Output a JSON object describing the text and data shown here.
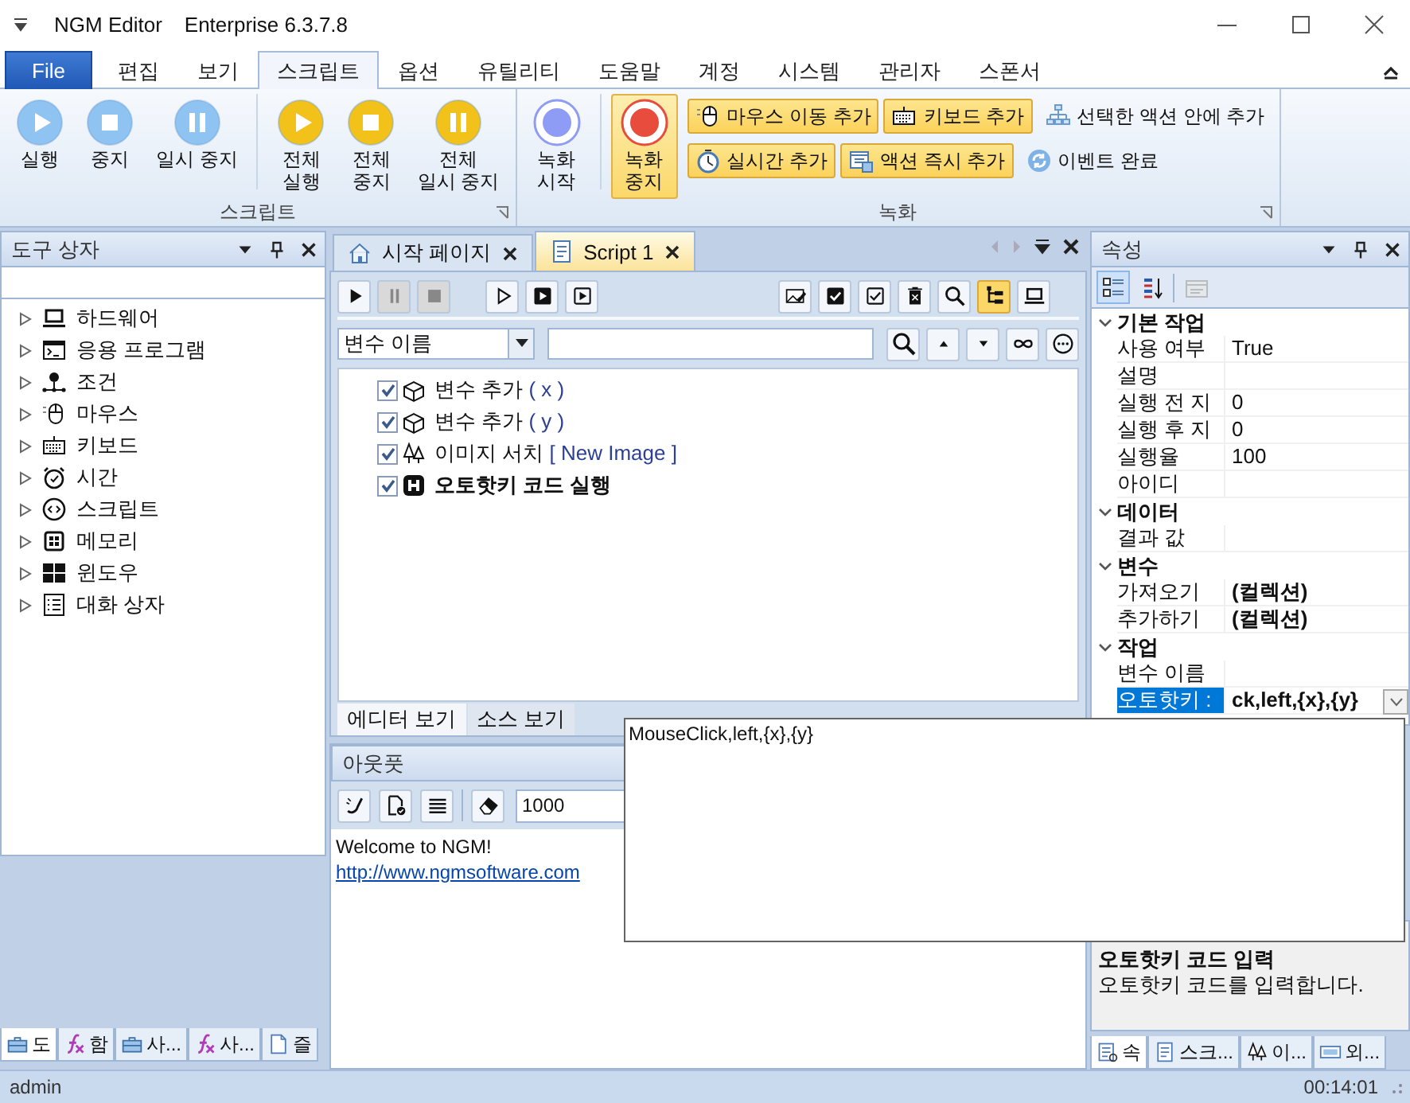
{
  "window": {
    "title": "NGM Editor",
    "edition": "Enterprise 6.3.7.8"
  },
  "menu_tabs": [
    {
      "label": "File",
      "kind": "file",
      "selected": false
    },
    {
      "label": "편집",
      "kind": "tab",
      "selected": false
    },
    {
      "label": "보기",
      "kind": "tab",
      "selected": false
    },
    {
      "label": "스크립트",
      "kind": "tab",
      "selected": true
    },
    {
      "label": "옵션",
      "kind": "tab",
      "selected": false
    },
    {
      "label": "유틸리티",
      "kind": "tab",
      "selected": false
    },
    {
      "label": "도움말",
      "kind": "tab",
      "selected": false
    },
    {
      "label": "계정",
      "kind": "tab",
      "selected": false
    },
    {
      "label": "시스템",
      "kind": "tab",
      "selected": false
    },
    {
      "label": "관리자",
      "kind": "tab",
      "selected": false
    },
    {
      "label": "스폰서",
      "kind": "tab",
      "selected": false
    }
  ],
  "ribbon": {
    "groups": [
      {
        "title": "스크립트",
        "big_buttons": [
          {
            "label": "실행",
            "kind": "play",
            "color": "#8ec3f2",
            "selected": false
          },
          {
            "label": "중지",
            "kind": "stop",
            "color": "#8ec3f2",
            "selected": false
          },
          {
            "label": "일시 중지",
            "kind": "pause",
            "color": "#8ec3f2",
            "selected": false
          },
          {
            "label": "전체\n실행",
            "kind": "play",
            "color": "#f2c21b",
            "selected": false
          },
          {
            "label": "전체\n중지",
            "kind": "stop",
            "color": "#f2c21b",
            "selected": false
          },
          {
            "label": "전체\n일시 중지",
            "kind": "pause",
            "color": "#f2c21b",
            "selected": false
          }
        ]
      },
      {
        "title": "녹화",
        "big_buttons": [
          {
            "label": "녹화\n시작",
            "kind": "record",
            "color": "#8f9cf5",
            "selected": false
          },
          {
            "label": "녹화\n중지",
            "kind": "record",
            "color": "#e74c3c",
            "selected": true
          }
        ],
        "small_rows": [
          {
            "buttons": [
              {
                "label": "마우스 이동 추가",
                "kind": "mouse",
                "highlighted": true
              },
              {
                "label": "키보드 추가",
                "kind": "keyboard",
                "highlighted": true
              },
              {
                "label": "선택한 액션 안에 추가",
                "kind": "network",
                "highlighted": false
              }
            ]
          },
          {
            "buttons": [
              {
                "label": "실시간 추가",
                "kind": "stopwatch",
                "highlighted": true
              },
              {
                "label": "액션 즉시 추가",
                "kind": "form",
                "highlighted": true
              },
              {
                "label": "이벤트 완료",
                "kind": "refresh",
                "highlighted": false
              }
            ]
          }
        ]
      }
    ]
  },
  "toolbox": {
    "title": "도구 상자",
    "items": [
      {
        "label": "하드웨어",
        "kind": "laptop",
        "expanded": false
      },
      {
        "label": "응용 프로그램",
        "kind": "terminal",
        "expanded": false
      },
      {
        "label": "조건",
        "kind": "pin",
        "expanded": false
      },
      {
        "label": "마우스",
        "kind": "mouse",
        "expanded": false
      },
      {
        "label": "키보드",
        "kind": "keyboard",
        "expanded": false
      },
      {
        "label": "시간",
        "kind": "clock",
        "expanded": false
      },
      {
        "label": "스크립트",
        "kind": "code",
        "expanded": false
      },
      {
        "label": "메모리",
        "kind": "chip",
        "expanded": false
      },
      {
        "label": "윈도우",
        "kind": "windows",
        "expanded": false
      },
      {
        "label": "대화 상자",
        "kind": "checklist",
        "expanded": false
      }
    ],
    "tabs": [
      {
        "label": "도",
        "kind": "toolbox",
        "selected": true
      },
      {
        "label": "함",
        "kind": "function",
        "selected": false
      },
      {
        "label": "사...",
        "kind": "toolbox",
        "selected": false
      },
      {
        "label": "사...",
        "kind": "function",
        "selected": false
      },
      {
        "label": "즐",
        "kind": "document",
        "selected": false
      }
    ]
  },
  "editor": {
    "tabs": [
      {
        "label": "시작 페이지",
        "kind": "home",
        "selected": false
      },
      {
        "label": "Script 1",
        "kind": "script",
        "selected": true
      }
    ],
    "toolbar": [
      {
        "kind": "play",
        "disabled": false,
        "selected": false
      },
      {
        "kind": "pause",
        "disabled": true,
        "selected": false
      },
      {
        "kind": "stop",
        "disabled": true,
        "selected": false
      },
      {
        "kind": "play-outline",
        "disabled": false,
        "selected": false
      },
      {
        "kind": "play-box-filled",
        "disabled": false,
        "selected": false
      },
      {
        "kind": "play-box",
        "disabled": false,
        "selected": false
      },
      {
        "kind": "image-edit",
        "disabled": false,
        "selected": false
      },
      {
        "kind": "check-filled",
        "disabled": false,
        "selected": false
      },
      {
        "kind": "check",
        "disabled": false,
        "selected": false
      },
      {
        "kind": "trash",
        "disabled": false,
        "selected": false
      },
      {
        "kind": "search",
        "disabled": false,
        "selected": false
      },
      {
        "kind": "tree",
        "disabled": false,
        "selected": true
      },
      {
        "kind": "laptop",
        "disabled": false,
        "selected": false
      }
    ],
    "search": {
      "field": "변수 이름"
    },
    "actions": [
      {
        "label": "변수 추가",
        "detail": "( x )",
        "kind": "variable",
        "checked": true,
        "selected": false
      },
      {
        "label": "변수 추가",
        "detail": "( y )",
        "kind": "variable",
        "checked": true,
        "selected": false
      },
      {
        "label": "이미지 서치",
        "detail": "[ New  Image ]",
        "kind": "image",
        "checked": true,
        "selected": false
      },
      {
        "label": "오토핫키 코드 실행",
        "kind": "hotkey",
        "checked": true,
        "selected": true
      }
    ],
    "view_tabs": [
      {
        "label": "에디터 보기",
        "selected": true
      },
      {
        "label": "소스 보기",
        "selected": false
      }
    ]
  },
  "output": {
    "title": "아웃풋",
    "interval": "1000",
    "lines": [
      {
        "text": "Welcome to NGM!",
        "kind": "text"
      },
      {
        "text": "http://www.ngmsoftware.com",
        "kind": "link"
      }
    ]
  },
  "properties": {
    "title": "속성",
    "toolbar": [
      {
        "kind": "categorized",
        "selected": true,
        "disabled": false
      },
      {
        "kind": "alphabetical",
        "selected": false,
        "disabled": false
      },
      {
        "kind": "pages",
        "selected": false,
        "disabled": true
      }
    ],
    "categories": [
      {
        "title": "기본 작업",
        "expanded": true,
        "rows": [
          {
            "name": "사용 여부",
            "value": "True",
            "modified": false,
            "selected": false
          },
          {
            "name": "설명",
            "modified": false,
            "selected": false
          },
          {
            "name": "실행 전 지",
            "value": "0",
            "modified": false,
            "selected": false
          },
          {
            "name": "실행 후 지",
            "value": "0",
            "modified": false,
            "selected": false
          },
          {
            "name": "실행율",
            "value": "100",
            "modified": false,
            "selected": false
          },
          {
            "name": "아이디",
            "modified": false,
            "selected": false
          }
        ]
      },
      {
        "title": "데이터",
        "expanded": true,
        "rows": [
          {
            "name": "결과 값",
            "modified": false,
            "selected": false
          }
        ]
      },
      {
        "title": "변수",
        "expanded": true,
        "rows": [
          {
            "name": "가져오기",
            "value": "(컬렉션)",
            "modified": true,
            "selected": false
          },
          {
            "name": "추가하기",
            "value": "(컬렉션)",
            "modified": true,
            "selected": false
          }
        ]
      },
      {
        "title": "작업",
        "expanded": true,
        "rows": [
          {
            "name": "변수 이름",
            "modified": false,
            "selected": false
          },
          {
            "name": "오토핫키 :",
            "value": "ck,left,{x},{y}",
            "modified": true,
            "selected": true
          }
        ]
      }
    ],
    "description": {
      "title": "오토핫키 코드 입력",
      "text": "오토핫키 코드를 입력합니다."
    },
    "tabs": [
      {
        "label": "속",
        "kind": "properties",
        "selected": true
      },
      {
        "label": "스크...",
        "kind": "script",
        "selected": false
      },
      {
        "label": "이...",
        "kind": "image",
        "selected": false
      },
      {
        "label": "외...",
        "kind": "api",
        "selected": false
      }
    ]
  },
  "dropdown_editor": {
    "text": "MouseClick,left,{x},{y}"
  },
  "status_bar": {
    "user": "admin",
    "time": "00:14:01"
  }
}
